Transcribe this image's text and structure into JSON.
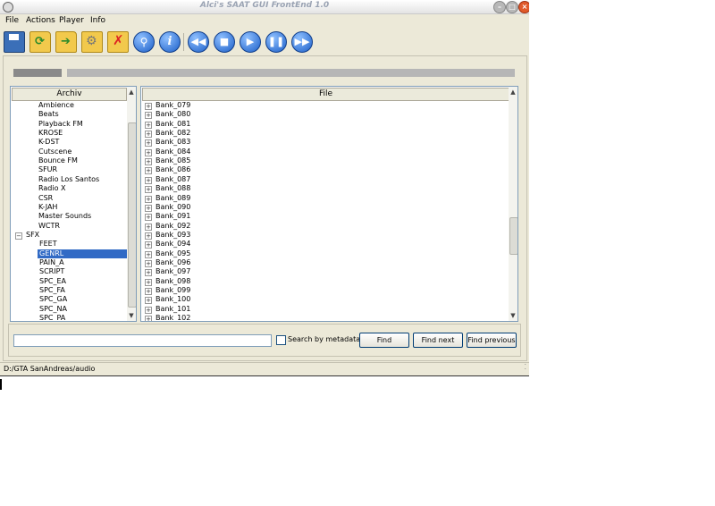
{
  "window": {
    "title": "Alci's SAAT GUI FrontEnd 1.0"
  },
  "menu": [
    "File",
    "Actions",
    "Player",
    "Info"
  ],
  "toolbar": {
    "icons": [
      "save-icon",
      "open-folder-icon",
      "folder-forward-icon",
      "folder-settings-icon",
      "delete-folder-icon",
      "search-icon",
      "info-icon",
      "rewind-icon",
      "stop-icon",
      "play-icon",
      "pause-icon",
      "fast-forward-icon"
    ]
  },
  "archive": {
    "header": "Archiv",
    "items": [
      "Ambience",
      "Beats",
      "Playback FM",
      "KROSE",
      "K-DST",
      "Cutscene",
      "Bounce FM",
      "SFUR",
      "Radio Los Santos",
      "Radio X",
      "CSR",
      "K-JAH",
      "Master Sounds",
      "WCTR"
    ],
    "group": "SFX",
    "group_items": [
      "FEET",
      "GENRL",
      "PAIN_A",
      "SCRIPT",
      "SPC_EA",
      "SPC_FA",
      "SPC_GA",
      "SPC_NA",
      "SPC_PA"
    ],
    "selected": "GENRL"
  },
  "files": {
    "header": "File",
    "items": [
      "Bank_079",
      "Bank_080",
      "Bank_081",
      "Bank_082",
      "Bank_083",
      "Bank_084",
      "Bank_085",
      "Bank_086",
      "Bank_087",
      "Bank_088",
      "Bank_089",
      "Bank_090",
      "Bank_091",
      "Bank_092",
      "Bank_093",
      "Bank_094",
      "Bank_095",
      "Bank_096",
      "Bank_097",
      "Bank_098",
      "Bank_099",
      "Bank_100",
      "Bank_101",
      "Bank_102"
    ]
  },
  "search": {
    "value": "",
    "metadata_label": "Search by metadata",
    "find": "Find",
    "find_next": "Find next",
    "find_previous": "Find previous"
  },
  "status": {
    "path": "D:/GTA SanAndreas/audio"
  },
  "colors": {
    "selection": "#316ac5",
    "window_bg": "#ece9d8"
  }
}
